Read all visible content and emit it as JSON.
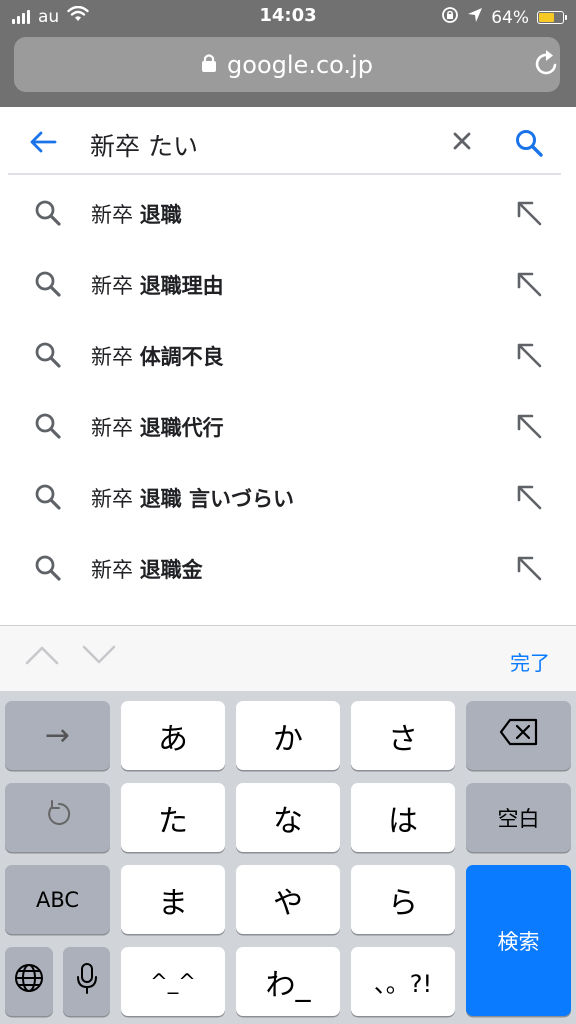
{
  "status_bar": {
    "carrier": "au",
    "time": "14:03",
    "battery_percent": "64%",
    "battery_level": 0.64,
    "icons": [
      "signal-bars-icon",
      "wifi-icon",
      "orientation-lock-icon",
      "location-arrow-icon",
      "battery-icon"
    ]
  },
  "browser": {
    "url": "google.co.jp",
    "icons": [
      "lock-icon",
      "reload-icon"
    ]
  },
  "search": {
    "query": "新卒 たい",
    "icons": [
      "back-arrow-icon",
      "clear-icon",
      "search-icon"
    ]
  },
  "suggestions": [
    {
      "prefix": "新卒 ",
      "completion": "退職"
    },
    {
      "prefix": "新卒 ",
      "completion": "退職理由"
    },
    {
      "prefix": "新卒 ",
      "completion": "体調不良"
    },
    {
      "prefix": "新卒 ",
      "completion": "退職代行"
    },
    {
      "prefix": "新卒 ",
      "completion": "退職 言いづらい"
    },
    {
      "prefix": "新卒 ",
      "completion": "退職金"
    }
  ],
  "accessory": {
    "done_label": "完了",
    "icons": [
      "chevron-up-icon",
      "chevron-down-icon"
    ]
  },
  "keyboard": {
    "row1": [
      "→",
      "あ",
      "か",
      "さ"
    ],
    "row2": [
      "た",
      "な",
      "は",
      "空白"
    ],
    "row3": [
      "ABC",
      "ま",
      "や",
      "ら"
    ],
    "row4": [
      "^_^",
      "わ_",
      "、。?!"
    ],
    "return_label": "検索",
    "icons": [
      "backspace-icon",
      "undo-icon",
      "globe-icon",
      "microphone-icon"
    ]
  },
  "colors": {
    "status_bar_bg": "#717171",
    "accent_blue": "#0a7aff",
    "google_blue": "#1a73e8",
    "keyboard_bg": "#d1d4d9",
    "battery_fill": "#f6c924"
  }
}
